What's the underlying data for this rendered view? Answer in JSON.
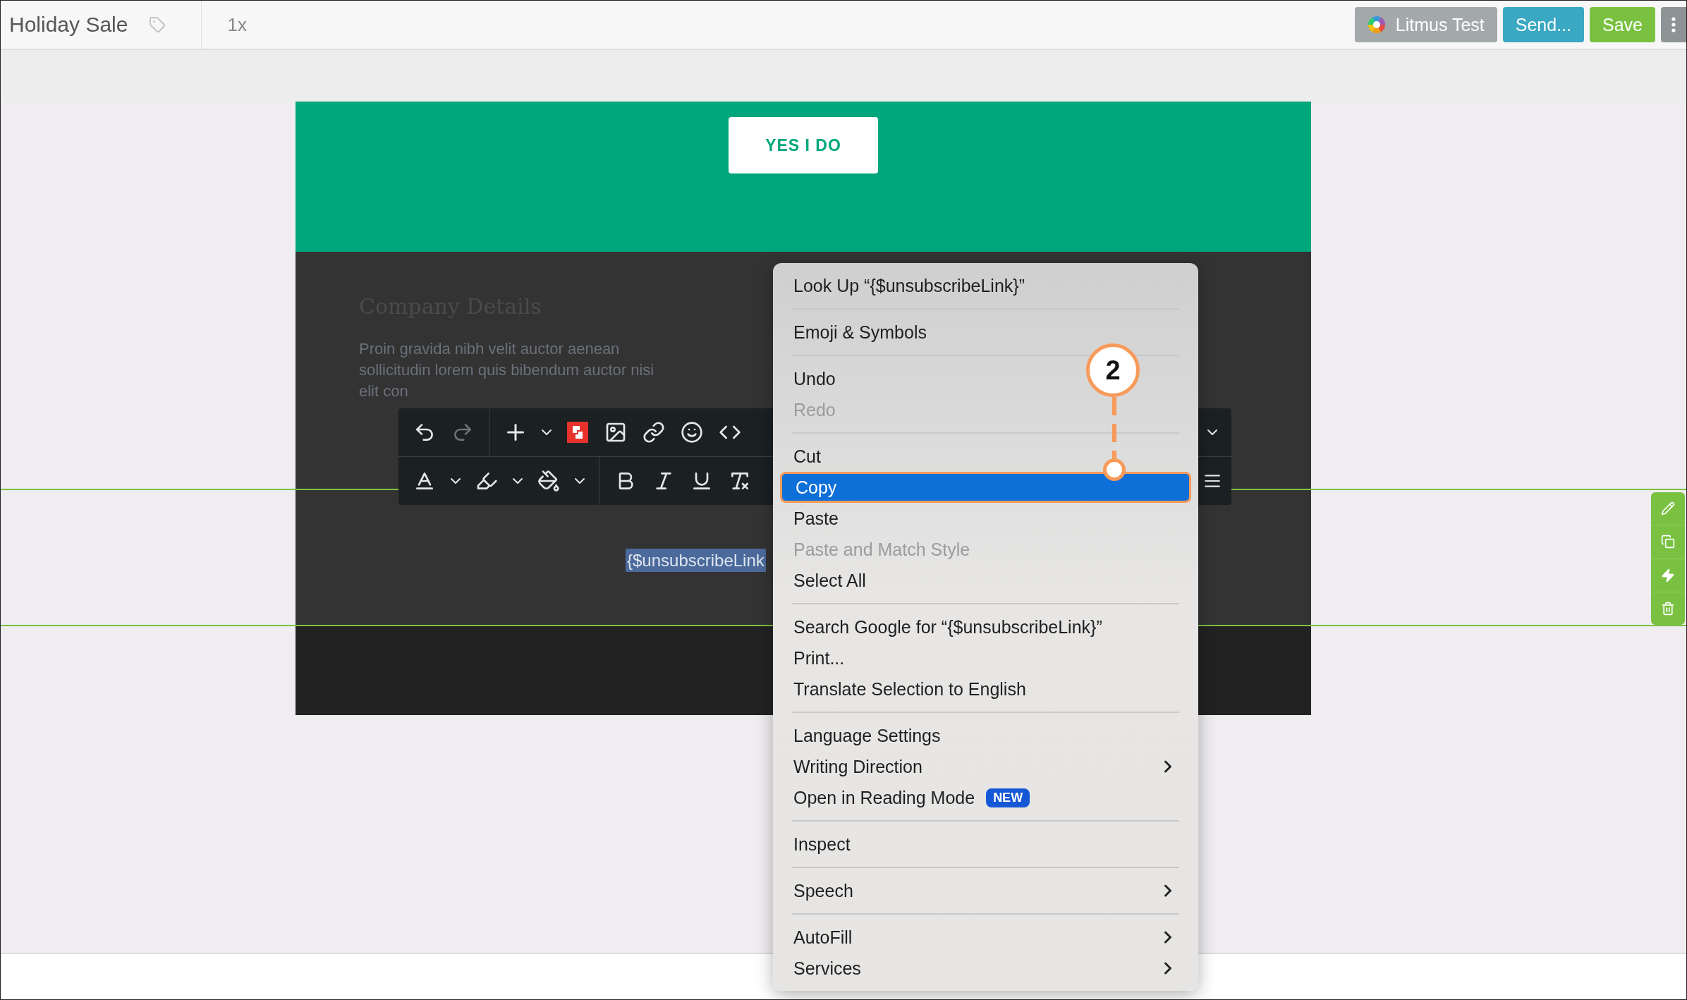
{
  "top_bar": {
    "title": "Holiday Sale",
    "zoom": "1x",
    "buttons": [
      {
        "label": "Litmus Test",
        "kind": "litmus",
        "color": "#a3a8ab"
      },
      {
        "label": "Send...",
        "kind": "plain",
        "color": "#3aa7c3"
      },
      {
        "label": "Save",
        "kind": "plain",
        "color": "#7ac142"
      }
    ]
  },
  "email": {
    "cta": "YES I DO",
    "heading": "Company Details",
    "paragraph": "Proin gravida nibh velit auctor aenean sollicitudin lorem quis bibendum auctor nisi elit con",
    "selected_text": "{$unsubscribeLink"
  },
  "toolbar": {
    "redo_disabled": true
  },
  "context_menu": {
    "groups": [
      [
        {
          "label": "Look Up “{$unsubscribeLink}”",
          "disabled": false,
          "selected": false
        }
      ],
      [
        {
          "label": "Emoji & Symbols",
          "disabled": false,
          "selected": false
        }
      ],
      [
        {
          "label": "Undo",
          "disabled": false,
          "selected": false
        },
        {
          "label": "Redo",
          "disabled": true,
          "selected": false
        }
      ],
      [
        {
          "label": "Cut",
          "disabled": false,
          "selected": false
        },
        {
          "label": "Copy",
          "disabled": false,
          "selected": true
        },
        {
          "label": "Paste",
          "disabled": false,
          "selected": false
        },
        {
          "label": "Paste and Match Style",
          "disabled": true,
          "selected": false
        },
        {
          "label": "Select All",
          "disabled": false,
          "selected": false
        }
      ],
      [
        {
          "label": "Search Google for “{$unsubscribeLink}”",
          "disabled": false,
          "selected": false
        },
        {
          "label": "Print...",
          "disabled": false,
          "selected": false
        },
        {
          "label": "Translate Selection to English",
          "disabled": false,
          "selected": false
        }
      ],
      [
        {
          "label": "Language Settings",
          "disabled": false,
          "selected": false
        },
        {
          "label": "Writing Direction",
          "disabled": false,
          "selected": false,
          "submenu": true
        },
        {
          "label": "Open in Reading Mode",
          "disabled": false,
          "selected": false,
          "badge": "NEW"
        }
      ],
      [
        {
          "label": "Inspect",
          "disabled": false,
          "selected": false
        }
      ],
      [
        {
          "label": "Speech",
          "disabled": false,
          "selected": false,
          "submenu": true
        }
      ],
      [
        {
          "label": "AutoFill",
          "disabled": false,
          "selected": false,
          "submenu": true
        },
        {
          "label": "Services",
          "disabled": false,
          "selected": false,
          "submenu": true
        }
      ]
    ]
  },
  "callout": {
    "label": "2"
  }
}
